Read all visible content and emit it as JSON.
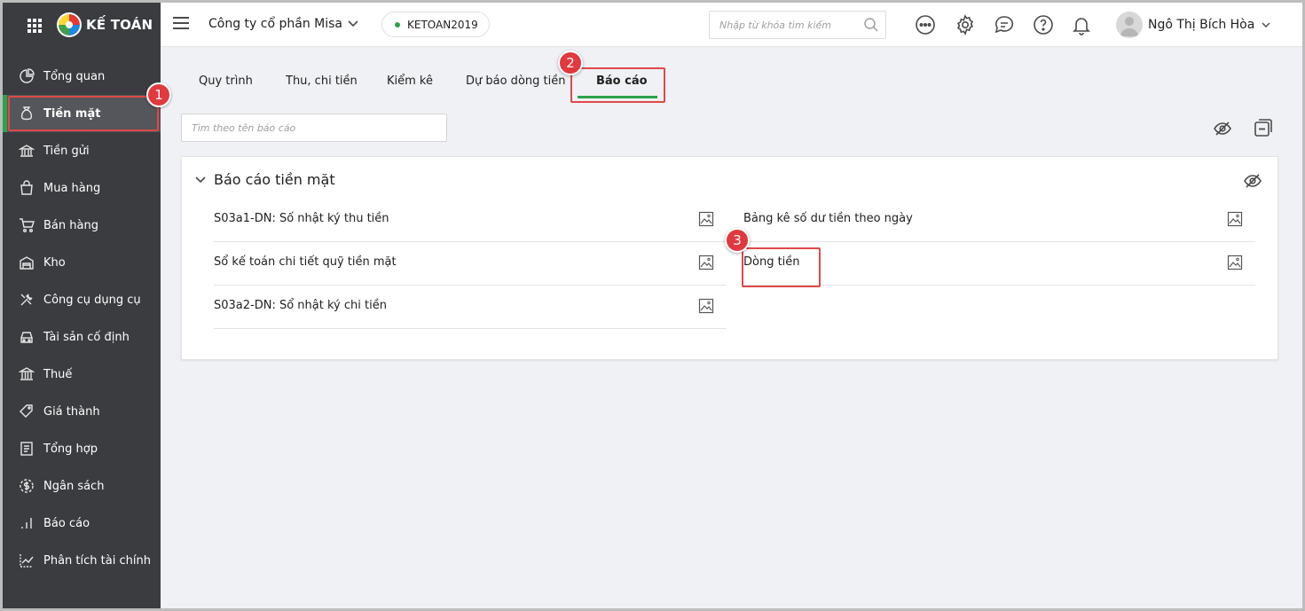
{
  "brand": {
    "name": "KẾ TOÁN"
  },
  "sidebar": {
    "items": [
      {
        "label": "Tổng quan",
        "icon": "chart-pie-icon"
      },
      {
        "label": "Tiền mặt",
        "icon": "money-bag-icon",
        "active": true
      },
      {
        "label": "Tiền gửi",
        "icon": "bank-deposit-icon"
      },
      {
        "label": "Mua hàng",
        "icon": "shopping-bag-icon"
      },
      {
        "label": "Bán hàng",
        "icon": "cart-icon"
      },
      {
        "label": "Kho",
        "icon": "warehouse-icon"
      },
      {
        "label": "Công cụ dụng cụ",
        "icon": "tools-icon"
      },
      {
        "label": "Tài sản cố định",
        "icon": "car-icon"
      },
      {
        "label": "Thuế",
        "icon": "government-icon"
      },
      {
        "label": "Giá thành",
        "icon": "price-tag-icon"
      },
      {
        "label": "Tổng hợp",
        "icon": "ledger-icon"
      },
      {
        "label": "Ngân sách",
        "icon": "budget-coin-icon"
      },
      {
        "label": "Báo cáo",
        "icon": "bar-chart-icon"
      },
      {
        "label": "Phân tích tài chính",
        "icon": "line-chart-icon"
      }
    ]
  },
  "header": {
    "company": "Công ty cổ phần Misa",
    "database": "KETOAN2019",
    "search_placeholder": "Nhập từ khóa tìm kiếm",
    "user_name": "Ngô Thị Bích Hòa"
  },
  "tabs": [
    {
      "label": "Quy trình"
    },
    {
      "label": "Thu, chi tiền"
    },
    {
      "label": "Kiểm kê"
    },
    {
      "label": "Dự báo dòng tiền"
    },
    {
      "label": "Báo cáo",
      "active": true
    }
  ],
  "content": {
    "search_placeholder": "Tìm theo tên báo cáo",
    "group": {
      "title": "Báo cáo tiền mặt",
      "left_reports": [
        {
          "label": "S03a1-DN: Số nhật ký thu tiền"
        },
        {
          "label": "Sổ kế toán chi tiết quỹ tiền mặt"
        },
        {
          "label": "S03a2-DN: Sổ nhật ký chi tiền"
        }
      ],
      "right_reports": [
        {
          "label": "Bảng kê số dư tiền theo ngày"
        },
        {
          "label": "Dòng tiền"
        }
      ]
    }
  },
  "annotations": {
    "step1": "1",
    "step2": "2",
    "step3": "3"
  },
  "colors": {
    "sidebar_bg": "#3b3c40",
    "accent_green": "#2ba24c",
    "highlight_red": "#e04848",
    "badge_red": "#e0393e"
  }
}
